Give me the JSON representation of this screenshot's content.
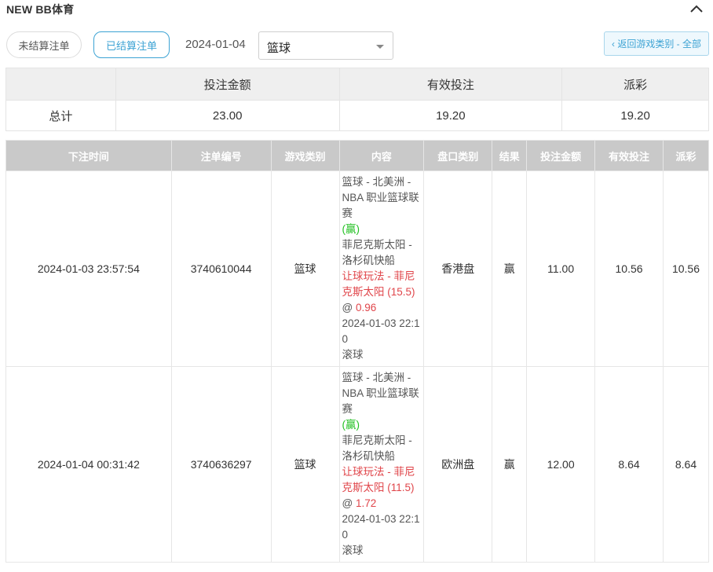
{
  "header": {
    "title": "NEW BB体育"
  },
  "toolbar": {
    "unsettled_label": "未结算注单",
    "settled_label": "已结算注单",
    "date": "2024-01-04",
    "sport_select": "篮球",
    "back_label": "‹ 返回游戏类别 - 全部"
  },
  "summary": {
    "headers": [
      "投注金额",
      "有效投注",
      "派彩"
    ],
    "row_label": "总计",
    "values": [
      "23.00",
      "19.20",
      "19.20"
    ]
  },
  "table": {
    "columns": [
      "下注时间",
      "注单编号",
      "游戏类别",
      "内容",
      "盘口类别",
      "结果",
      "投注金额",
      "有效投注",
      "派彩"
    ],
    "rows": [
      {
        "time": "2024-01-03 23:57:54",
        "bet_id": "3740610044",
        "game_type": "篮球",
        "content": {
          "league": "篮球 - 北美洲 - NBA 职业篮球联赛",
          "result_tag": "(赢)",
          "match": "菲尼克斯太阳 - 洛杉矶快船",
          "market": "让球玩法 - 菲尼克斯太阳 (15.5)",
          "at": "@",
          "odds": "0.96",
          "match_time": "2024-01-03 22:10",
          "mode": "滚球"
        },
        "handicap_type": "香港盘",
        "result": "赢",
        "stake": "11.00",
        "valid": "10.56",
        "payout": "10.56"
      },
      {
        "time": "2024-01-04 00:31:42",
        "bet_id": "3740636297",
        "game_type": "篮球",
        "content": {
          "league": "篮球 - 北美洲 - NBA 职业篮球联赛",
          "result_tag": "(赢)",
          "match": "菲尼克斯太阳 - 洛杉矶快船",
          "market": "让球玩法 - 菲尼克斯太阳 (11.5)",
          "at": "@",
          "odds": "1.72",
          "match_time": "2024-01-03 22:10",
          "mode": "滚球"
        },
        "handicap_type": "欧洲盘",
        "result": "赢",
        "stake": "12.00",
        "valid": "8.64",
        "payout": "8.64"
      }
    ]
  },
  "colors": {
    "accent": "#3da3d4",
    "win": "#22c022",
    "red": "#e0454a",
    "header_bg": "#c9c9c9"
  },
  "icons": {
    "collapse": "chevron-up-icon",
    "select": "caret-down-icon"
  }
}
